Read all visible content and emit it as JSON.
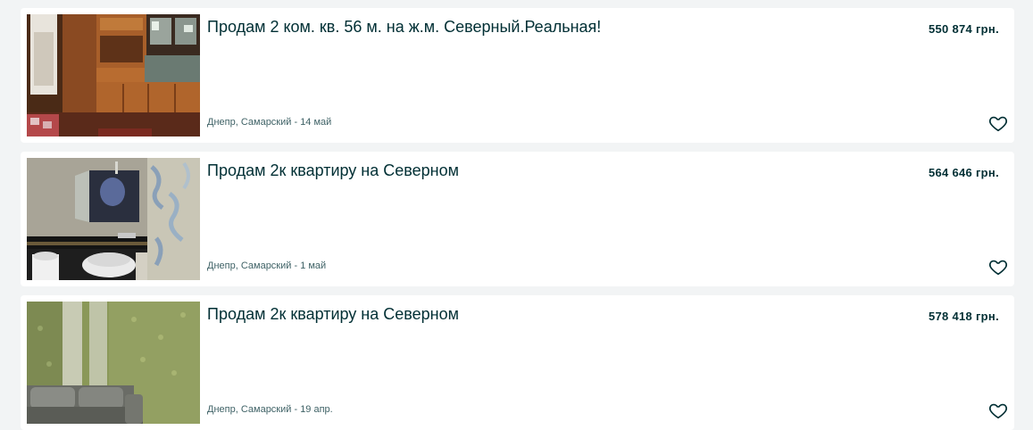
{
  "listings": [
    {
      "title": "Продам 2 ком. кв. 56 м. на ж.м. Северный.Реальная!",
      "location_date": "Днепр, Самарский - 14 май",
      "price": "550 874 грн.",
      "favorite_icon": "heart-outline-icon",
      "photo": "living-room-wall-unit"
    },
    {
      "title": "Продам 2к квартиру на Северном",
      "location_date": "Днепр, Самарский - 1 май",
      "price": "564 646 грн.",
      "favorite_icon": "heart-outline-icon",
      "photo": "bathroom-sink-mirror"
    },
    {
      "title": "Продам 2к квартиру на Северном",
      "location_date": "Днепр, Самарский - 19 апр.",
      "price": "578 418 грн.",
      "favorite_icon": "heart-outline-icon",
      "photo": "room-with-sofa"
    }
  ],
  "colors": {
    "page_background": "#f2f4f5",
    "card_background": "#ffffff",
    "text_primary": "#002f34",
    "text_secondary": "#406367"
  }
}
